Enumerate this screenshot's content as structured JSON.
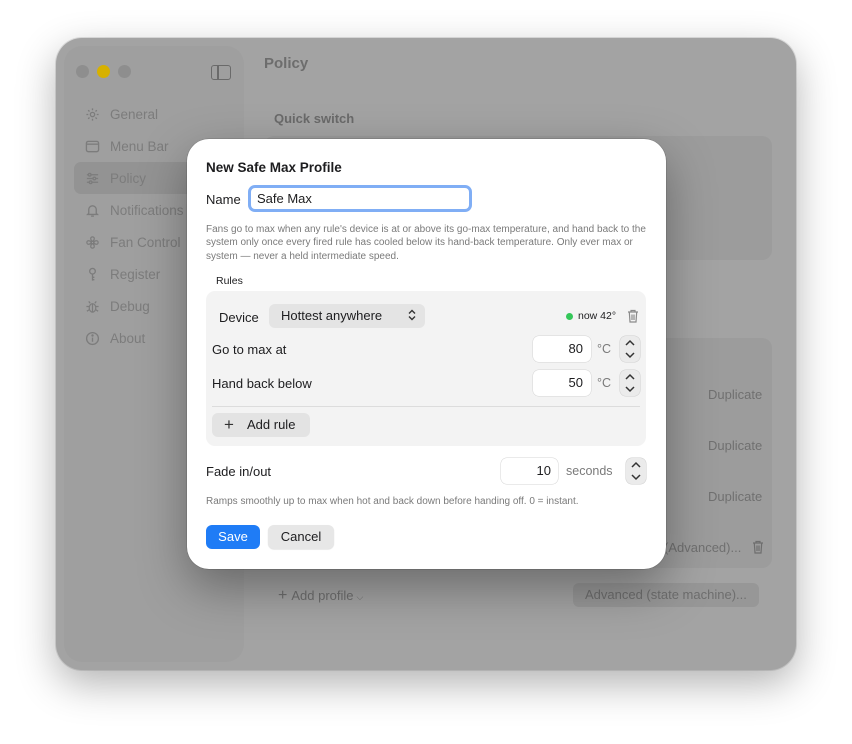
{
  "window": {
    "title": "Policy",
    "section_label": "Quick switch"
  },
  "sidebar": {
    "items": [
      {
        "label": "General",
        "icon": "gear-icon"
      },
      {
        "label": "Menu Bar",
        "icon": "menubar-icon"
      },
      {
        "label": "Policy",
        "icon": "sliders-icon",
        "active": true
      },
      {
        "label": "Notifications",
        "icon": "bell-icon"
      },
      {
        "label": "Fan Control",
        "icon": "fan-icon"
      },
      {
        "label": "Register",
        "icon": "key-icon"
      },
      {
        "label": "Debug",
        "icon": "bug-icon"
      },
      {
        "label": "About",
        "icon": "info-icon"
      }
    ]
  },
  "background": {
    "duplicate_labels": [
      "Duplicate",
      "Duplicate",
      "Duplicate"
    ],
    "advanced_fragment": "(Advanced)...",
    "add_profile_label": "Add profile",
    "advanced_button_label": "Advanced (state machine)..."
  },
  "dialog": {
    "title": "New Safe Max Profile",
    "name_label": "Name",
    "name_value": "Safe Max",
    "description": "Fans go to max when any rule's device is at or above its go-max temperature, and hand back to the system only once every fired rule has cooled below its hand-back temperature. Only ever max or system — never a held intermediate speed.",
    "rules_label": "Rules",
    "rule": {
      "device_label": "Device",
      "device_value": "Hottest anywhere",
      "current_temp": "now 42°",
      "go_max_label": "Go to max at",
      "go_max_value": "80",
      "hand_back_label": "Hand back below",
      "hand_back_value": "50",
      "unit": "°C"
    },
    "add_rule_label": "Add rule",
    "fade_label": "Fade in/out",
    "fade_value": "10",
    "fade_unit": "seconds",
    "hint": "Ramps smoothly up to max when hot and back down before handing off. 0 = instant.",
    "save_label": "Save",
    "cancel_label": "Cancel"
  },
  "colors": {
    "accent": "#1f7cf6",
    "status_green": "#34c759",
    "focus_ring": "#80aef5"
  }
}
